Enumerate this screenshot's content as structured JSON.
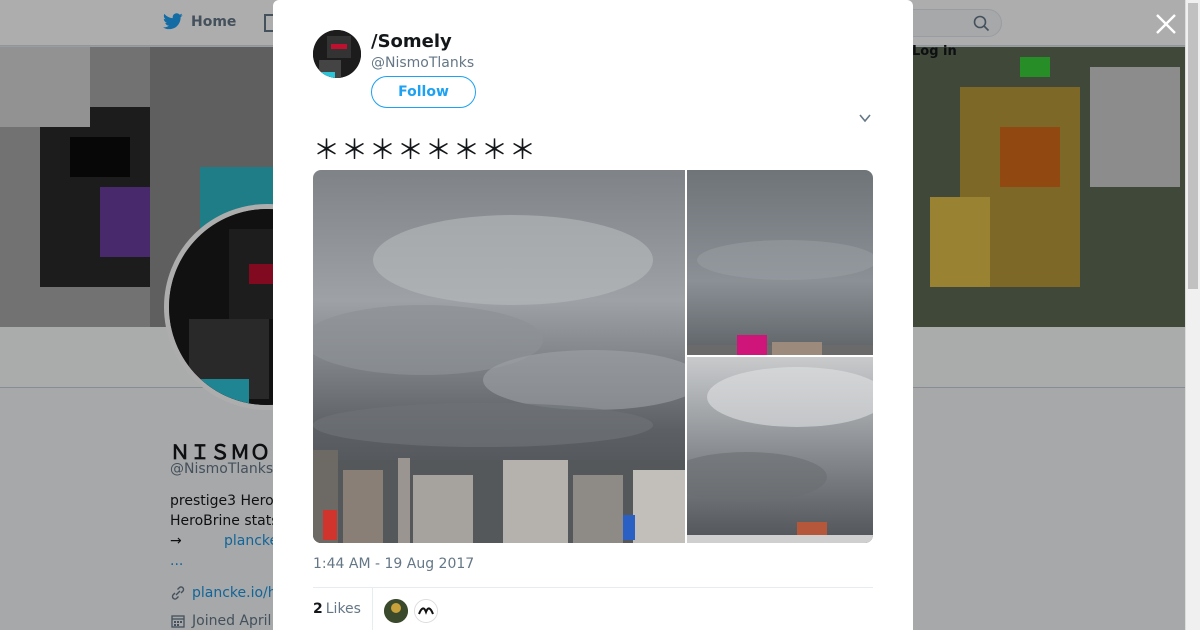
{
  "header": {
    "home_label": "Home",
    "login_label": "Log in"
  },
  "profile": {
    "name": "ＮＩＳＭＯＴＬＡＮＫＳ",
    "handle": "@NismoTlanks",
    "bio_line1": "prestige3 Hero",
    "bio_line2": "HeroBrine stats",
    "bio_line3": "→",
    "bio_link": "plancke",
    "ellipsis": "...",
    "url": "plancke.io/h",
    "joined": "Joined April"
  },
  "tweet": {
    "author_name": "/Somely",
    "author_handle": "@NismoTlanks",
    "follow_label": "Follow",
    "text": "＊＊＊＊＊＊＊＊",
    "timestamp": "1:44 AM - 19 Aug 2017",
    "likes_count": "2",
    "likes_label": "Likes"
  },
  "colors": {
    "accent": "#1da1f2",
    "link": "#1b95e0",
    "secondary_text": "#657786"
  },
  "icons": [
    "twitter-bird-icon",
    "search-icon",
    "close-icon",
    "chevron-down-icon",
    "link-icon",
    "calendar-icon"
  ]
}
